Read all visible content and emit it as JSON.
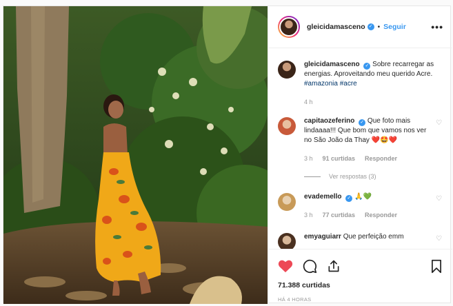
{
  "header": {
    "username": "gleicidamasceno",
    "follow_label": "Seguir",
    "dot": "•",
    "more_icon": "more-horizontal-icon"
  },
  "caption": {
    "username": "gleicidamasceno",
    "text": "Sobre recarregar as energias. Aproveitando meu querido Acre.",
    "hashtags": [
      "#amazonia",
      "#acre"
    ],
    "time": "4 h"
  },
  "comments": [
    {
      "username": "capitaozeferino",
      "verified": true,
      "text": "Que foto mais lindaaaa!!! Que bom que vamos nos ver no São João da Thay",
      "emoji": "❤️🤩❤️",
      "time": "3 h",
      "likes": "91 curtidas",
      "reply_label": "Responder",
      "view_replies": "Ver respostas (3)"
    },
    {
      "username": "evademello",
      "verified": true,
      "text": "",
      "emoji": "🙏💚",
      "time": "3 h",
      "likes": "77 curtidas",
      "reply_label": "Responder"
    },
    {
      "username": "emyaguiarr",
      "verified": false,
      "text": "Que perfeição emm",
      "emoji": ""
    }
  ],
  "footer": {
    "likes": "71.388 curtidas",
    "timestamp": "HÁ 4 HORAS"
  },
  "colors": {
    "like_red": "#ed4956",
    "link_blue": "#3897f0",
    "hashtag": "#003569",
    "muted": "#999999"
  }
}
